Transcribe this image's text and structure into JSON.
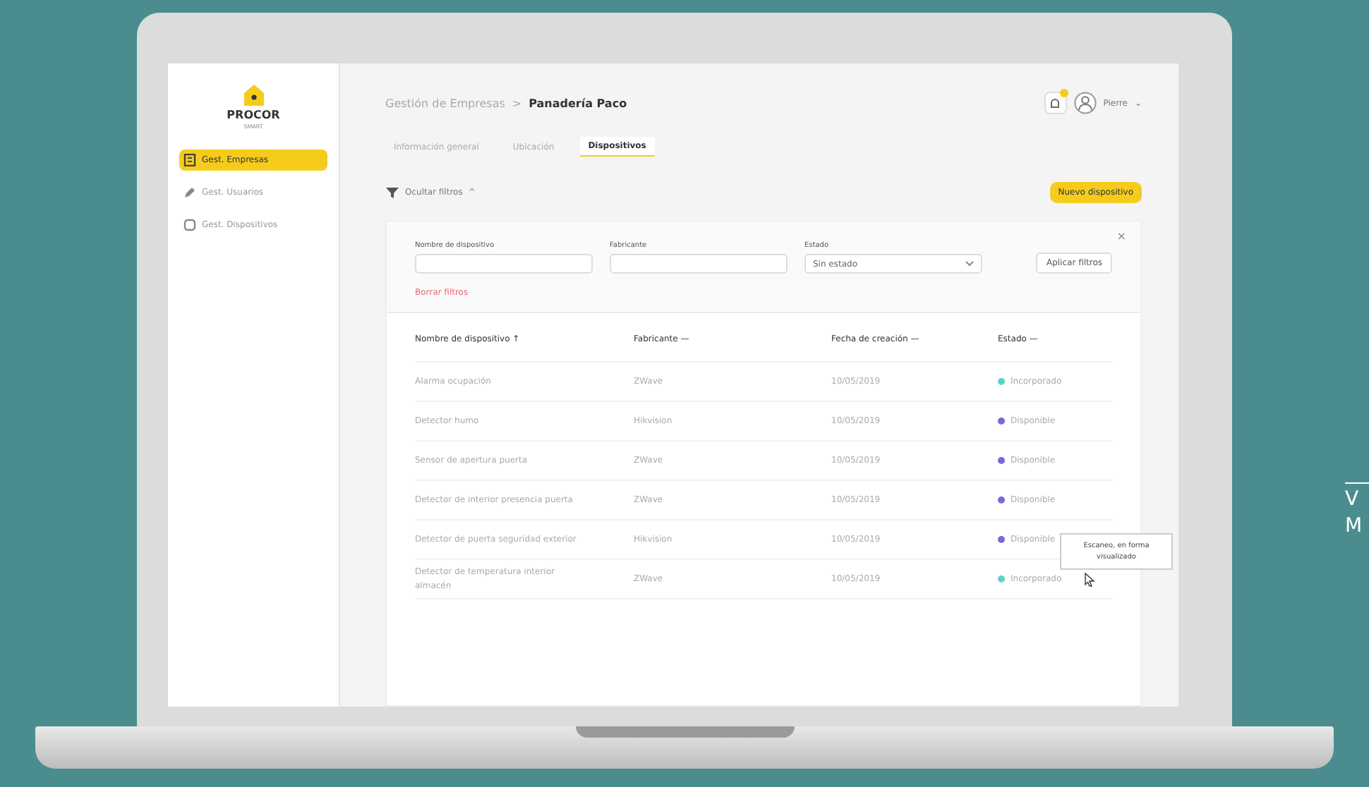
{
  "sidebar": {
    "logo": "PROCOR",
    "logo_subtitle": "SMART",
    "items": [
      {
        "label": "Gest. Empresas",
        "kind": "building",
        "selected": true
      },
      {
        "label": "Gest. Usuarios",
        "kind": "pencil",
        "selected": false
      },
      {
        "label": "Gest. Dispositivos",
        "kind": "device",
        "selected": false
      }
    ]
  },
  "header": {
    "breadcrumb": [
      "Gestión de Empresas",
      "Panadería Paco"
    ],
    "separator": ">",
    "user": "Pierre",
    "caret": "⌄"
  },
  "tabs": [
    {
      "label": "Información general",
      "selected": false
    },
    {
      "label": "Ubicación",
      "selected": false
    },
    {
      "label": "Dispositivos",
      "selected": true
    }
  ],
  "toolbar": {
    "toggle": "Ocultar filtros",
    "toggle_caret": "^",
    "new_button": "Nuevo dispositivo"
  },
  "filters": {
    "close": "×",
    "fields": [
      {
        "label": "Nombre de dispositivo",
        "kind": "text"
      },
      {
        "label": "Fabricante",
        "kind": "text"
      },
      {
        "label": "Estado",
        "kind": "select",
        "value": "Sin estado"
      }
    ],
    "apply": "Aplicar filtros",
    "clear": "Borrar filtros"
  },
  "table": {
    "columns": [
      {
        "label": "Nombre de dispositivo",
        "sort": "↑"
      },
      {
        "label": "Fabricante",
        "sort": "—"
      },
      {
        "label": "Fecha de creación",
        "sort": "—"
      },
      {
        "label": "Estado",
        "sort": "—"
      }
    ],
    "rows": [
      {
        "name": "Alarma ocupación",
        "maker": "ZWave",
        "date": "10/05/2019",
        "status": "Incorporado",
        "color": "#5fd3c8"
      },
      {
        "name": "Detector humo",
        "maker": "Hikvision",
        "date": "10/05/2019",
        "status": "Disponible",
        "color": "#7b68d6"
      },
      {
        "name": "Sensor de apertura puerta",
        "maker": "ZWave",
        "date": "10/05/2019",
        "status": "Disponible",
        "color": "#7b68d6"
      },
      {
        "name": "Detector de interior presencia puerta",
        "maker": "ZWave",
        "date": "10/05/2019",
        "status": "Disponible",
        "color": "#7b68d6"
      },
      {
        "name": "Detector de puerta seguridad exterior",
        "maker": "Hikvision",
        "date": "10/05/2019",
        "status": "Disponible",
        "color": "#7b68d6"
      },
      {
        "name": "Detector de temperatura interior almacén",
        "maker": "ZWave",
        "date": "10/05/2019",
        "status": "Incorporado",
        "color": "#5fd3c8"
      }
    ]
  },
  "tooltip": "Escaneo, en forma visualizado",
  "side_text": [
    "V",
    "M"
  ]
}
